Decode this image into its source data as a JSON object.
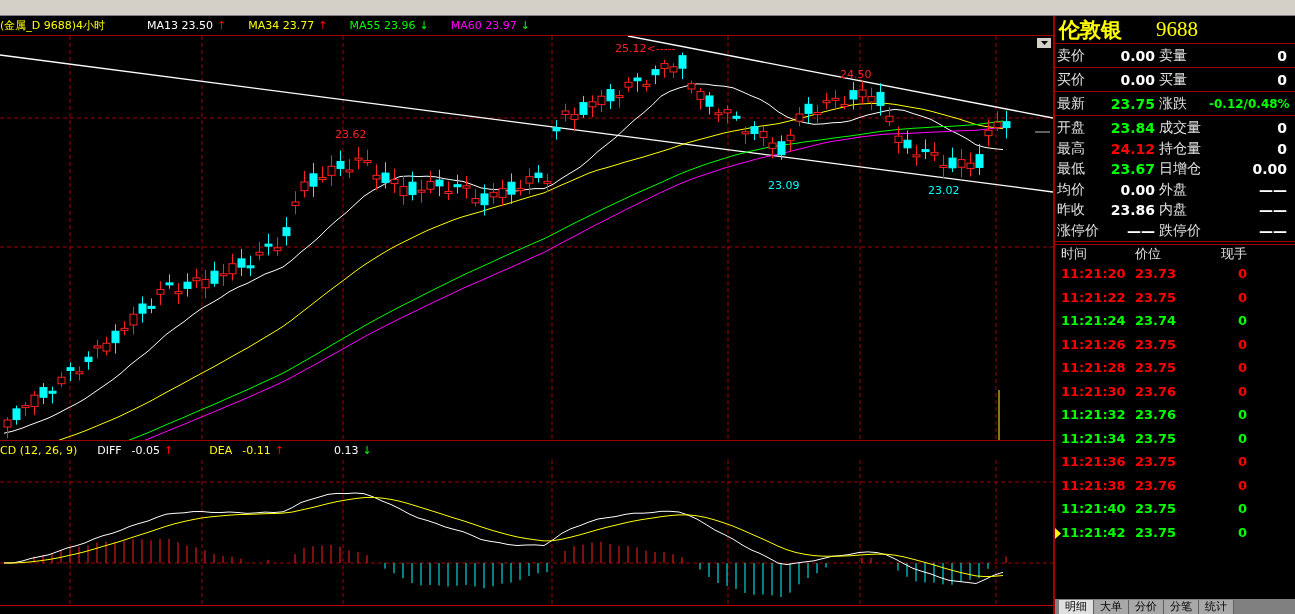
{
  "chart": {
    "title": "(金属_D 9688)4小时",
    "indicators": [
      {
        "label": "MA13 23.50",
        "color": "#ffffff",
        "arrow": "↑",
        "rising": true
      },
      {
        "label": "MA34 23.77",
        "color": "#ffff00",
        "arrow": "↑",
        "rising": true
      },
      {
        "label": "MA55 23.96",
        "color": "#00ff00",
        "arrow": "↓",
        "rising": false
      },
      {
        "label": "MA60 23.97",
        "color": "#ff00ff",
        "arrow": "↓",
        "rising": false
      }
    ],
    "annotations": [
      {
        "text": "25.12<-----",
        "kind": "high"
      },
      {
        "text": "24.50",
        "kind": "high"
      },
      {
        "text": "23.62",
        "kind": "high"
      },
      {
        "text": "23.09",
        "kind": "low"
      },
      {
        "text": "23.02",
        "kind": "low"
      }
    ]
  },
  "macd": {
    "title": "CD (12, 26, 9)",
    "values": [
      {
        "name": "DIFF",
        "value": "-0.05",
        "arrow": "↑",
        "rising": true,
        "color": "#ffffff"
      },
      {
        "name": "DEA",
        "value": "-0.11",
        "arrow": "↑",
        "rising": true,
        "color": "#ffff00"
      },
      {
        "value": "0.13",
        "arrow": "↓",
        "rising": false,
        "color": "#ffffff"
      }
    ]
  },
  "quote": {
    "name": "伦敦银",
    "code": "9688",
    "sections": [
      {
        "rows": [
          [
            {
              "label": "卖价",
              "value": "0.00",
              "color": "#ffffff"
            },
            {
              "label": "卖量",
              "value": "0",
              "color": "#ffffff"
            }
          ]
        ]
      },
      {
        "rows": [
          [
            {
              "label": "买价",
              "value": "0.00",
              "color": "#ffffff"
            },
            {
              "label": "买量",
              "value": "0",
              "color": "#ffffff"
            }
          ]
        ]
      },
      {
        "rows": [
          [
            {
              "label": "最新",
              "value": "23.75",
              "color": "#00ff00"
            },
            {
              "label": "涨跌",
              "value": "-0.12/0.48%",
              "color": "#00ff00"
            }
          ]
        ]
      },
      {
        "rows": [
          [
            {
              "label": "开盘",
              "value": "23.84",
              "color": "#00ff00"
            },
            {
              "label": "成交量",
              "value": "0",
              "color": "#ffffff"
            }
          ],
          [
            {
              "label": "最高",
              "value": "24.12",
              "color": "#ff0000"
            },
            {
              "label": "持仓量",
              "value": "0",
              "color": "#ffffff"
            }
          ],
          [
            {
              "label": "最低",
              "value": "23.67",
              "color": "#00ff00"
            },
            {
              "label": "日增仓",
              "value": "0.00",
              "color": "#ffffff"
            }
          ],
          [
            {
              "label": "均价",
              "value": "0.00",
              "color": "#ffffff"
            },
            {
              "label": "外盘",
              "value": "——",
              "color": "#ffffff"
            }
          ],
          [
            {
              "label": "昨收",
              "value": "23.86",
              "color": "#ffffff"
            },
            {
              "label": "内盘",
              "value": "——",
              "color": "#ffffff"
            }
          ],
          [
            {
              "label": "涨停价",
              "value": "——",
              "color": "#ffffff"
            },
            {
              "label": "跌停价",
              "value": "——",
              "color": "#ffffff"
            }
          ]
        ]
      }
    ]
  },
  "ticks": {
    "columns": [
      "时间",
      "价位",
      "现手"
    ],
    "rows": [
      {
        "time": "11:21:20",
        "price": "23.73",
        "volume": "0",
        "color": "#ff0000",
        "selected": false
      },
      {
        "time": "11:21:22",
        "price": "23.75",
        "volume": "0",
        "color": "#ff0000",
        "selected": false
      },
      {
        "time": "11:21:24",
        "price": "23.74",
        "volume": "0",
        "color": "#00ff00",
        "selected": false
      },
      {
        "time": "11:21:26",
        "price": "23.75",
        "volume": "0",
        "color": "#ff0000",
        "selected": false
      },
      {
        "time": "11:21:28",
        "price": "23.75",
        "volume": "0",
        "color": "#ff0000",
        "selected": false
      },
      {
        "time": "11:21:30",
        "price": "23.76",
        "volume": "0",
        "color": "#ff0000",
        "selected": false
      },
      {
        "time": "11:21:32",
        "price": "23.76",
        "volume": "0",
        "color": "#00ff00",
        "selected": false
      },
      {
        "time": "11:21:34",
        "price": "23.75",
        "volume": "0",
        "color": "#00ff00",
        "selected": false
      },
      {
        "time": "11:21:36",
        "price": "23.75",
        "volume": "0",
        "color": "#ff0000",
        "selected": false
      },
      {
        "time": "11:21:38",
        "price": "23.76",
        "volume": "0",
        "color": "#ff0000",
        "selected": false
      },
      {
        "time": "11:21:40",
        "price": "23.75",
        "volume": "0",
        "color": "#00ff00",
        "selected": false
      },
      {
        "time": "11:21:42",
        "price": "23.75",
        "volume": "0",
        "color": "#00ff00",
        "selected": true
      }
    ]
  },
  "tabs": [
    {
      "label": "明细",
      "selected": true
    },
    {
      "label": "大单",
      "selected": false
    },
    {
      "label": "分价",
      "selected": false
    },
    {
      "label": "分笔",
      "selected": false
    },
    {
      "label": "统计",
      "selected": false
    }
  ]
}
